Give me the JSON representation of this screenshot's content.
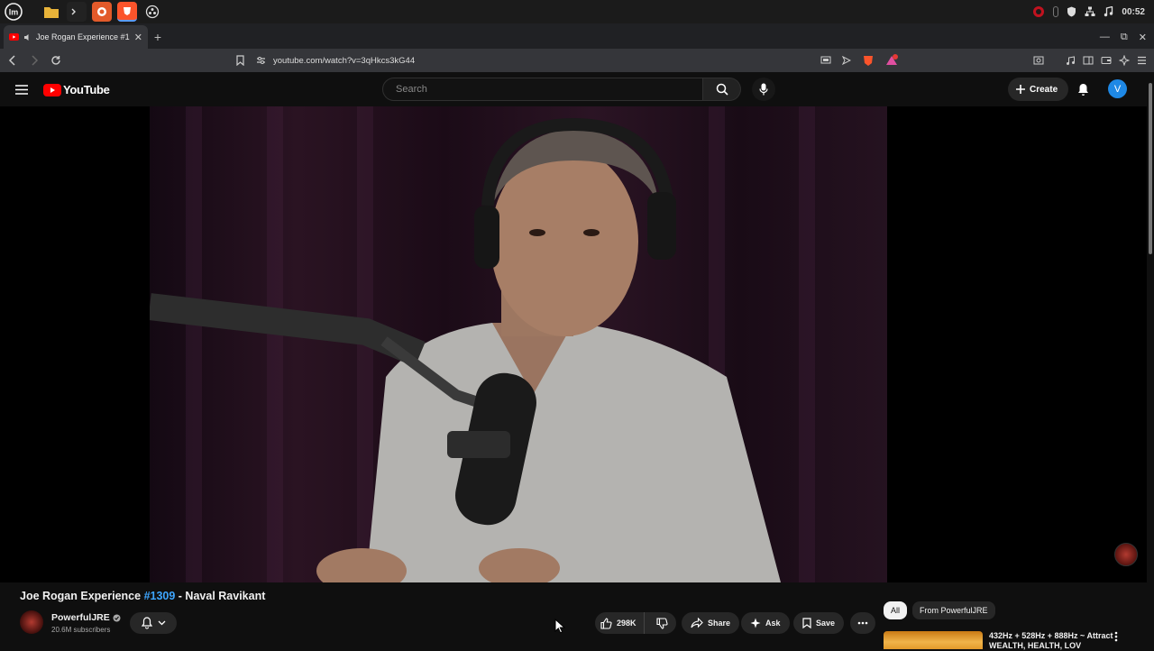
{
  "browser": {
    "tab_title": "Joe Rogan Experience #1",
    "url": "youtube.com/watch?v=3qHkcs3kG44",
    "clock": "00:52",
    "colors": {
      "youtube_red": "#ff0000",
      "accent_blue": "#3ea6ff",
      "avatar_blue": "#1e88e5"
    }
  },
  "header": {
    "logo_text": "YouTube",
    "search_placeholder": "Search",
    "create_label": "Create",
    "avatar_letter": "V"
  },
  "video": {
    "title_prefix": "Joe Rogan Experience ",
    "title_hashtag": "#1309",
    "title_suffix": " - Naval Ravikant"
  },
  "channel": {
    "name": "PowerfulJRE",
    "subscribers": "20.6M subscribers"
  },
  "actions": {
    "likes": "298K",
    "share_label": "Share",
    "ask_label": "Ask",
    "save_label": "Save"
  },
  "sidebar": {
    "chips": [
      "All",
      "From PowerfulJRE"
    ],
    "recommendation_title": "432Hz + 528Hz + 888Hz ~ Attract WEALTH, HEALTH, LOV"
  }
}
